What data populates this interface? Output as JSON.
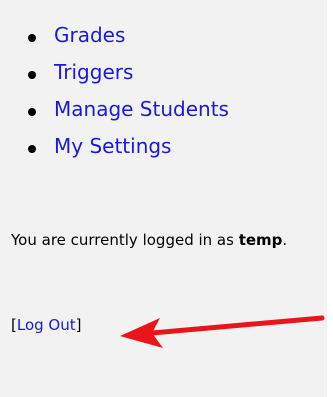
{
  "nav": {
    "items": [
      {
        "label": "Grades"
      },
      {
        "label": "Triggers"
      },
      {
        "label": "Manage Students"
      },
      {
        "label": "My Settings"
      }
    ]
  },
  "login": {
    "prefix": "You are currently logged in as ",
    "username": "temp",
    "suffix": ".",
    "bracket_open": "[",
    "logout_label": "Log Out",
    "bracket_close": "]"
  },
  "colors": {
    "panel_background": "#f2f2f2",
    "link": "#1a1ad6",
    "annotation_arrow": "#e8161b"
  }
}
